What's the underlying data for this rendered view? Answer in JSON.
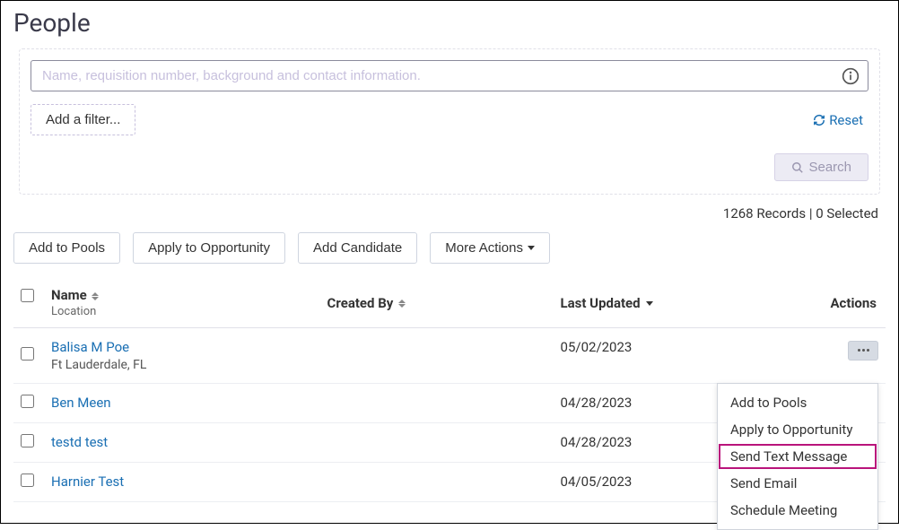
{
  "page": {
    "title": "People"
  },
  "search": {
    "placeholder": "Name, requisition number, background and contact information.",
    "addFilterLabel": "Add a filter...",
    "resetLabel": "Reset",
    "searchButtonLabel": "Search"
  },
  "recordsBar": {
    "count": "1268 Records",
    "separator": " | ",
    "selected": "0 Selected"
  },
  "buttons": {
    "addToPools": "Add to Pools",
    "applyToOpportunity": "Apply to Opportunity",
    "addCandidate": "Add Candidate",
    "moreActions": "More Actions"
  },
  "table": {
    "headers": {
      "name": "Name",
      "nameSub": "Location",
      "createdBy": "Created By",
      "lastUpdated": "Last Updated",
      "actions": "Actions"
    },
    "rows": [
      {
        "name": "Balisa M Poe",
        "location": "Ft Lauderdale, FL",
        "createdBy": "",
        "lastUpdated": "05/02/2023",
        "showMore": true
      },
      {
        "name": "Ben Meen",
        "location": "",
        "createdBy": "",
        "lastUpdated": "04/28/2023",
        "showMore": false
      },
      {
        "name": "testd test",
        "location": "",
        "createdBy": "",
        "lastUpdated": "04/28/2023",
        "showMore": false
      },
      {
        "name": "Harnier Test",
        "location": "",
        "createdBy": "",
        "lastUpdated": "04/05/2023",
        "showMore": false
      }
    ]
  },
  "dropdown": {
    "items": [
      {
        "label": "Add to Pools",
        "highlight": false
      },
      {
        "label": "Apply to Opportunity",
        "highlight": false
      },
      {
        "label": "Send Text Message",
        "highlight": true
      },
      {
        "label": "Send Email",
        "highlight": false
      },
      {
        "label": "Schedule Meeting",
        "highlight": false
      }
    ]
  }
}
